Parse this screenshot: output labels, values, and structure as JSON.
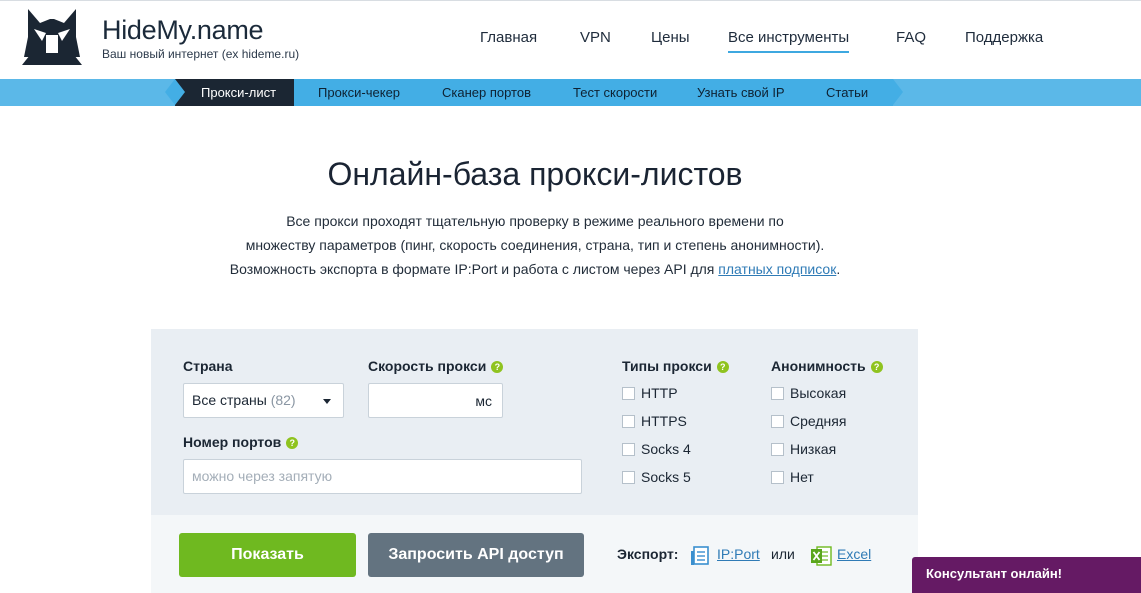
{
  "header": {
    "logo_name": "HideMy.name",
    "logo_tagline": "Ваш новый интернет (ex hideme.ru)",
    "nav": [
      {
        "label": "Главная"
      },
      {
        "label": "VPN"
      },
      {
        "label": "Цены"
      },
      {
        "label": "Все инструменты",
        "active": true
      },
      {
        "label": "FAQ"
      },
      {
        "label": "Поддержка"
      }
    ]
  },
  "subnav": [
    {
      "label": "Прокси-лист",
      "active": true
    },
    {
      "label": "Прокси-чекер"
    },
    {
      "label": "Сканер портов"
    },
    {
      "label": "Тест скорости"
    },
    {
      "label": "Узнать свой IP"
    },
    {
      "label": "Статьи"
    }
  ],
  "hero": {
    "title": "Онлайн-база прокси-листов",
    "desc_line1": "Все прокси проходят тщательную проверку в режиме реального времени по",
    "desc_line2": "множеству параметров (пинг, скорость соединения, страна, тип и степень анонимности).",
    "desc_line3_prefix": "Возможность экспорта в формате IP:Port и работа с листом через API для ",
    "desc_link": "платных подписок",
    "desc_line3_suffix": "."
  },
  "filters": {
    "country_label": "Страна",
    "country_value": "Все страны",
    "country_count": "(82)",
    "speed_label": "Скорость прокси",
    "speed_unit": "мс",
    "ports_label": "Номер портов",
    "ports_placeholder": "можно через запятую",
    "types_label": "Типы прокси",
    "types": [
      "HTTP",
      "HTTPS",
      "Socks 4",
      "Socks 5"
    ],
    "anon_label": "Анонимность",
    "anon": [
      "Высокая",
      "Средняя",
      "Низкая",
      "Нет"
    ]
  },
  "actions": {
    "show_label": "Показать",
    "api_label": "Запросить API доступ",
    "export_label": "Экспорт:",
    "ipport_label": "IP:Port",
    "or_label": "или",
    "excel_label": "Excel"
  },
  "consultant": {
    "label": "Консультант онлайн!"
  },
  "colors": {
    "accent_blue": "#43aee5",
    "show_button": "#6fb920",
    "api_button": "#637380",
    "consultant": "#651a64",
    "help_badge": "#8fc31f"
  }
}
